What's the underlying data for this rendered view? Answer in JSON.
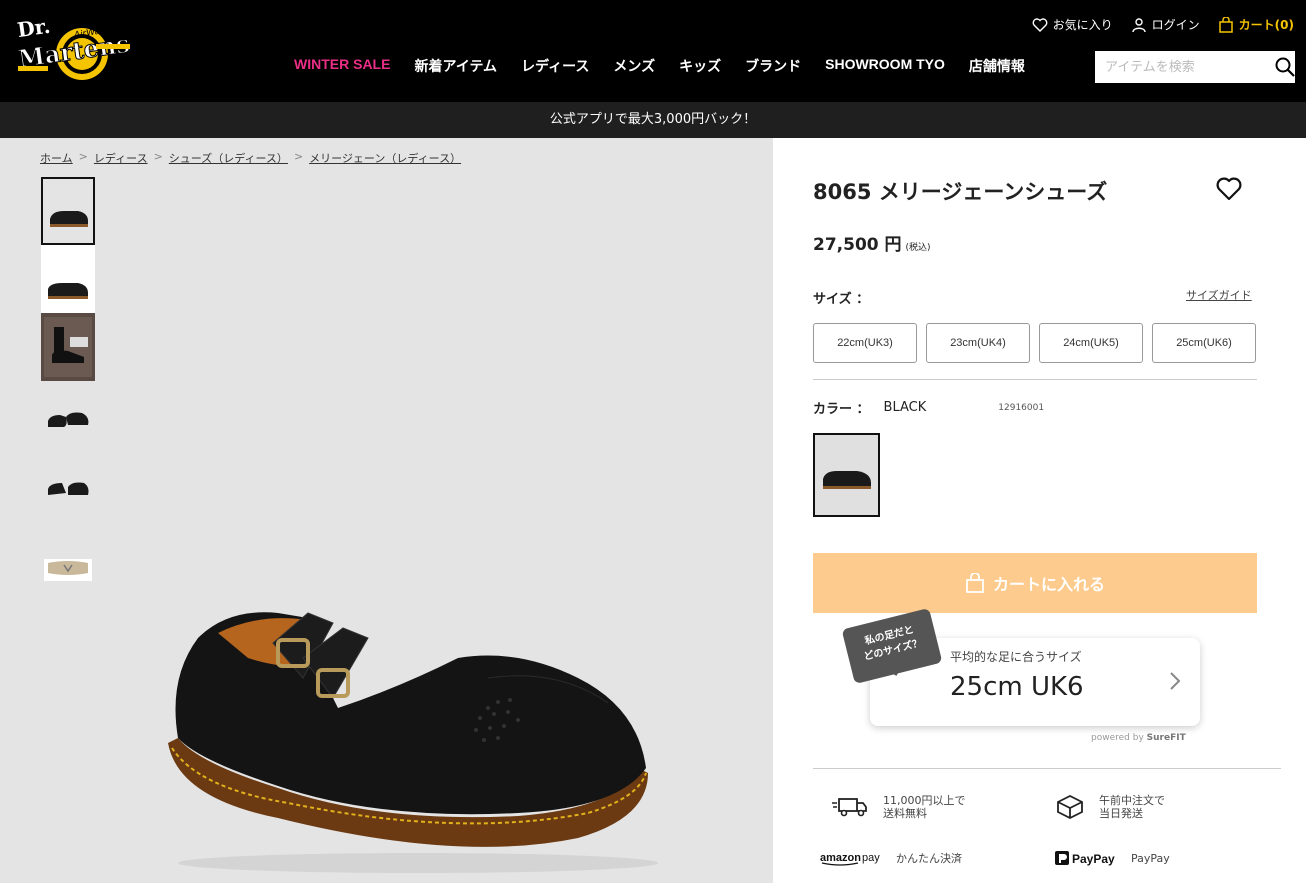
{
  "header": {
    "logo_text": "Dr. Martens AirWair",
    "util": {
      "favorites": "お気に入り",
      "login": "ログイン",
      "cart": "カート(0)"
    },
    "nav": [
      "WINTER SALE",
      "新着アイテム",
      "レディース",
      "メンズ",
      "キッズ",
      "ブランド",
      "SHOWROOM TYO",
      "店舗情報"
    ],
    "search_placeholder": "アイテムを検索"
  },
  "promo": "公式アプリで最大3,000円バック！",
  "breadcrumb": [
    "ホーム",
    "レディース",
    "シューズ（レディース）",
    "メリージェーン（レディース）"
  ],
  "product": {
    "title": "8065 メリージェーンシューズ",
    "price": "27,500 円",
    "tax": "(税込)",
    "size_label": "サイズ ：",
    "size_guide": "サイズガイド",
    "sizes": [
      "22cm(UK3)",
      "23cm(UK4)",
      "24cm(UK5)",
      "25cm(UK6)"
    ],
    "color_label": "カラー ：",
    "color_value": "BLACK",
    "color_code": "12916001",
    "cart_button": "カートに入れる"
  },
  "surefit": {
    "bubble": "私の足だと\nどのサイズ？",
    "subtitle": "平均的な足に合うサイズ",
    "size": "25cm UK6",
    "powered_by": "powered by",
    "brand": "SureFIT"
  },
  "features": [
    {
      "icon": "truck-icon",
      "text": "11,000円以上で\n送料無料"
    },
    {
      "icon": "box-icon",
      "text": "午前中注文で\n当日発送"
    },
    {
      "icon": "amazon-pay-logo",
      "text": "かんたん決済"
    },
    {
      "icon": "paypay-logo",
      "text": "PayPay"
    }
  ],
  "colors": {
    "sale": "#ea2e86",
    "cart": "#f5c400",
    "cart_button": "#fdcb8d"
  }
}
